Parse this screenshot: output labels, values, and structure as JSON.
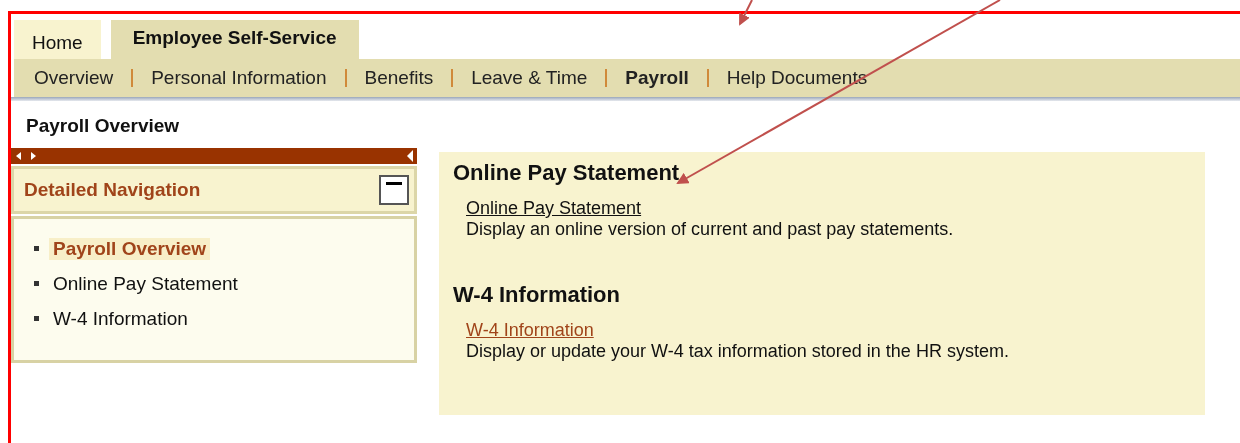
{
  "tabs": [
    {
      "label": "Home",
      "selected": false
    },
    {
      "label": "Employee Self-Service",
      "selected": true
    }
  ],
  "subnav": [
    {
      "label": "Overview",
      "selected": false
    },
    {
      "label": "Personal Information",
      "selected": false
    },
    {
      "label": "Benefits",
      "selected": false
    },
    {
      "label": "Leave & Time",
      "selected": false
    },
    {
      "label": "Payroll",
      "selected": true
    },
    {
      "label": "Help Documents",
      "selected": false
    }
  ],
  "page_title": "Payroll Overview",
  "detailed_navigation": {
    "title": "Detailed Navigation",
    "expanded": true,
    "items": [
      {
        "label": "Payroll Overview",
        "selected": true
      },
      {
        "label": "Online Pay Statement",
        "selected": false
      },
      {
        "label": "W-4 Information",
        "selected": false
      }
    ]
  },
  "sections": [
    {
      "heading": "Online Pay Statement",
      "link": "Online Pay Statement",
      "visited": false,
      "description": "Display an online version of current and past pay statements."
    },
    {
      "heading": "W-4 Information",
      "link": "W-4 Information",
      "visited": true,
      "description": "Display or update your W-4 tax information stored in the HR system."
    }
  ]
}
